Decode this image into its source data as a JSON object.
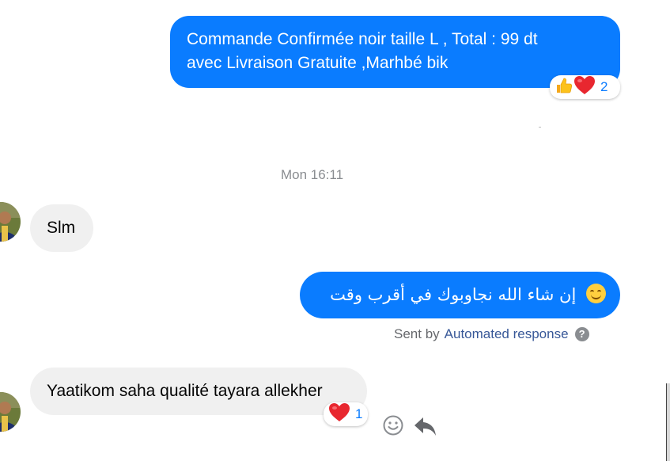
{
  "messages": {
    "order_confirm": {
      "line1": "Commande Confirmée noir taille L , Total : 99 dt",
      "line2": "avec Livraison Gratuite ,Marhbé bik",
      "reactions": [
        "thumbs-up",
        "heart"
      ],
      "reaction_count": "2"
    },
    "timestamp": "Mon 16:11",
    "slm": {
      "text": "Slm"
    },
    "auto_reply": {
      "text": "إن شاء الله نجاوبوك في أقرب وقت",
      "emoji": "smiling-face"
    },
    "sent_by": {
      "prefix": "Sent by",
      "source": "Automated response",
      "help": "?"
    },
    "feedback": {
      "text": "Yaatikom saha qualité tayara allekher",
      "reactions": [
        "heart"
      ],
      "reaction_count": "1"
    }
  },
  "colors": {
    "outgoing_bubble": "#0a7cff",
    "incoming_bubble": "#f0f0f0",
    "reaction_count": "#0a7cff",
    "link": "#385898"
  }
}
